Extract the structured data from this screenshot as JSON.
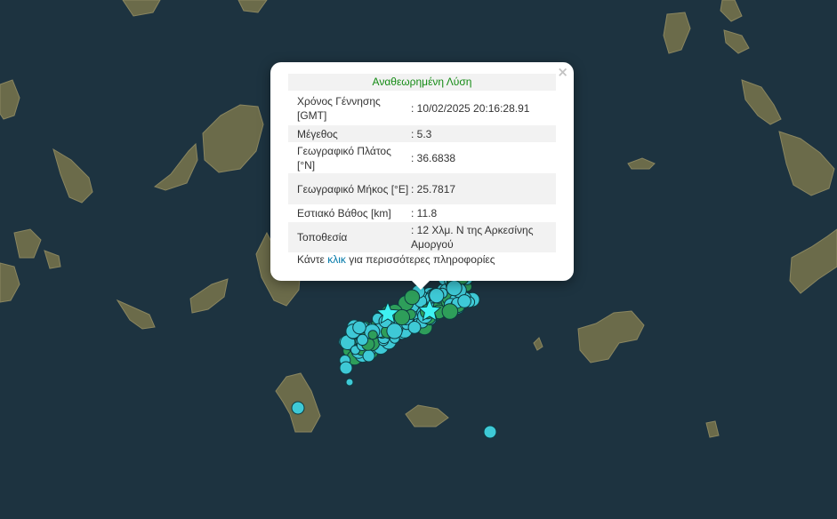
{
  "popup": {
    "title": "Αναθεωρημένη Λύση",
    "close_symbol": "×",
    "rows": [
      {
        "label": "Χρόνος Γέννησης [GMT]",
        "value": ": 10/02/2025 20:16:28.91"
      },
      {
        "label": "Μέγεθος",
        "value": ": 5.3"
      },
      {
        "label": "Γεωγραφικό Πλάτος [°N]",
        "value": ": 36.6838"
      },
      {
        "label": "Γεωγραφικό Μήκος [°E]",
        "value": ": 25.7817"
      },
      {
        "label": "Εστιακό Βάθος [km]",
        "value": ": 11.8"
      },
      {
        "label": "Τοποθεσία",
        "value": ": 12 Χλμ. Ν της Αρκεσίνης Αμοργού"
      }
    ],
    "more_prefix": "Κάντε ",
    "more_link": "κλικ",
    "more_suffix": " για περισσότερες πληροφορίες"
  },
  "colors": {
    "sea": "#1d3340",
    "land": "#6b6b4a",
    "event_cyan": "#3ec9d6",
    "event_green": "#2e9e5a",
    "star": "#3ef2f2",
    "title_green": "#138a13",
    "link_blue": "#0078a8"
  },
  "markers": {
    "icon": "earthquake-circle",
    "star_icon": "star-icon"
  }
}
